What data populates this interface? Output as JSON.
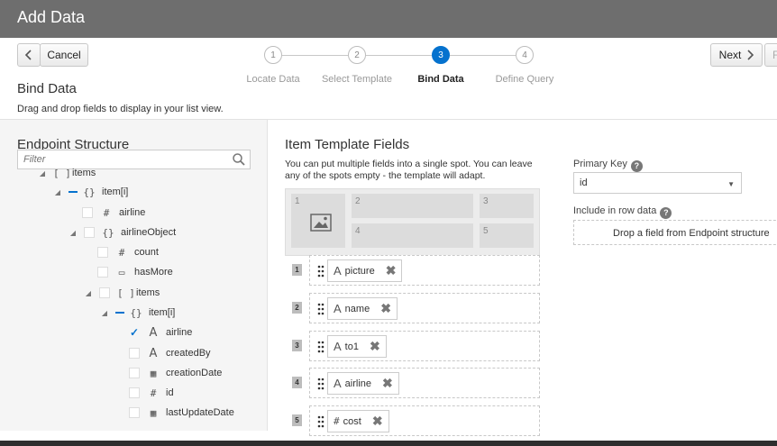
{
  "title": "Add Data",
  "nav": {
    "cancel_label": "Cancel",
    "next_label": "Next",
    "finish_label": "F"
  },
  "steps": [
    {
      "number": "1",
      "label": "Locate Data",
      "active": false
    },
    {
      "number": "2",
      "label": "Select Template",
      "active": false
    },
    {
      "number": "3",
      "label": "Bind Data",
      "active": true
    },
    {
      "number": "4",
      "label": "Define Query",
      "active": false
    }
  ],
  "section": {
    "title": "Bind Data",
    "description": "Drag and drop fields to display in your list view."
  },
  "endpoint": {
    "title": "Endpoint Structure",
    "filter_placeholder": "Filter",
    "tree": [
      {
        "label": "items",
        "icon": "array-icon"
      },
      {
        "label": "item[i]",
        "icon": "object-icon"
      },
      {
        "label": "airline",
        "icon": "number-icon"
      },
      {
        "label": "airlineObject",
        "icon": "object-icon"
      },
      {
        "label": "count",
        "icon": "number-icon"
      },
      {
        "label": "hasMore",
        "icon": "boolean-icon"
      },
      {
        "label": "items",
        "icon": "array-icon"
      },
      {
        "label": "item[i]",
        "icon": "object-icon"
      },
      {
        "label": "airline",
        "icon": "text-icon",
        "checked": true
      },
      {
        "label": "createdBy",
        "icon": "text-icon"
      },
      {
        "label": "creationDate",
        "icon": "calendar-icon"
      },
      {
        "label": "id",
        "icon": "number-icon"
      },
      {
        "label": "lastUpdateDate",
        "icon": "calendar-icon"
      }
    ]
  },
  "template": {
    "title": "Item Template Fields",
    "description": "You can put multiple fields into a single spot. You can leave any of the spots empty - the template will adapt.",
    "slots": [
      "1",
      "2",
      "3",
      "4",
      "5"
    ],
    "fields": [
      {
        "number": "1",
        "name": "picture",
        "icon": "text-icon"
      },
      {
        "number": "2",
        "name": "name",
        "icon": "text-icon"
      },
      {
        "number": "3",
        "name": "to1",
        "icon": "text-icon"
      },
      {
        "number": "4",
        "name": "airline",
        "icon": "text-icon"
      },
      {
        "number": "5",
        "name": "cost",
        "icon": "number-icon"
      }
    ]
  },
  "primary_key": {
    "label": "Primary Key",
    "value": "id"
  },
  "row_data": {
    "label": "Include in row data",
    "drop_text": "Drop a field from Endpoint structure"
  },
  "colors": {
    "accent": "#0572ce",
    "titlebar": "#6e6e6e"
  }
}
